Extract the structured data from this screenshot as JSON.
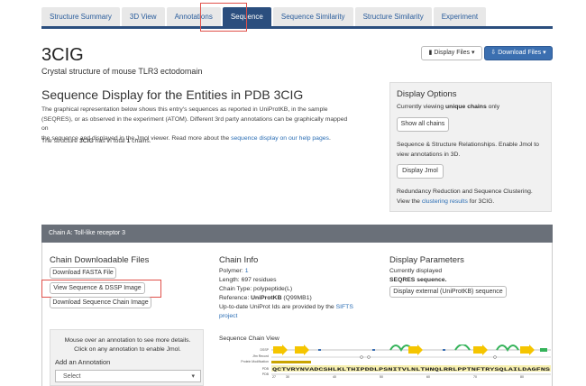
{
  "tabs": [
    "Structure Summary",
    "3D View",
    "Annotations",
    "Sequence",
    "Sequence Similarity",
    "Structure Similarity",
    "Experiment"
  ],
  "active_tab": "Sequence",
  "header": {
    "pdb_id": "3CIG",
    "subtitle": "Crystal structure of mouse TLR3 ectodomain",
    "display_files": "Display Files",
    "download_files": "Download Files"
  },
  "main": {
    "heading": "Sequence Display for the Entities in PDB 3CIG",
    "para_line1": "The graphical representation below shows this entry's sequences as reported in UniProtKB, in the sample",
    "para_line2": "(SEQRES), or as observed in the experiment (ATOM). Different 3rd party annotations can be graphically mapped on",
    "para_line3_a": "the sequence and displayed in the Jmol viewer. Read more about the ",
    "para_link": "sequence display on our help pages",
    "para_line3_b": ".",
    "total_a": "The structure ",
    "total_id": "3CIG",
    "total_b": " has in total ",
    "total_n": "1",
    "total_c": " chains."
  },
  "options": {
    "title": "Display Options",
    "viewing_a": "Currently viewing ",
    "viewing_b": "unique chains",
    "viewing_c": " only",
    "show_all": "Show all chains",
    "rel_line1": "Sequence & Structure Relationships. Enable Jmol to",
    "rel_line2": "view annotations in 3D.",
    "display_jmol": "Display Jmol",
    "red_line1": "Redundancy Reduction and Sequence Clustering.",
    "red_line2_a": "View the ",
    "red_link": "clustering results",
    "red_line2_b": " for 3CIG."
  },
  "chain": {
    "title": "Chain A: Toll-like receptor 3",
    "downloads_title": "Chain Downloadable Files",
    "fasta": "Download FASTA File",
    "view_seq": "View Sequence & DSSP Image",
    "dl_seq": "Download Sequence Chain Image",
    "info_title": "Chain Info",
    "polymer_l": "Polymer: ",
    "polymer": "1",
    "length": "Length: 697 residues",
    "type": "Chain Type: polypeptide(L)",
    "ref_l": "Reference: ",
    "ref_db": "UniProtKB",
    "ref_id": " (Q99MB1)",
    "upd1_a": "Up-to-date UniProt Ids are provided by the ",
    "upd1_link": "SIFTS",
    "upd2": "project",
    "params_title": "Display Parameters",
    "currently": "Currently displayed",
    "seqres": "SEQRES sequence.",
    "display_ext": "Display external (UniProtKB) sequence"
  },
  "annotation": {
    "line1": "Mouse over an annotation to see more details.",
    "line2": "Click on any annotation to enable Jmol.",
    "add_label": "Add an Annotation",
    "select": "Select"
  },
  "seqview": {
    "title": "Sequence Chain View",
    "row_labels": [
      "DSSP",
      "Jfm Record",
      "Protein Modification",
      "PDB",
      "PDB"
    ],
    "sequence": "QCTVRYNVADCSHLKLTHIPDDLPSNITVLNLTHNQLRRLPPTNFTRYSQLAILDAGFNS",
    "ticks": [
      "27",
      "30",
      "40",
      "50",
      "60",
      "70",
      "80"
    ]
  }
}
